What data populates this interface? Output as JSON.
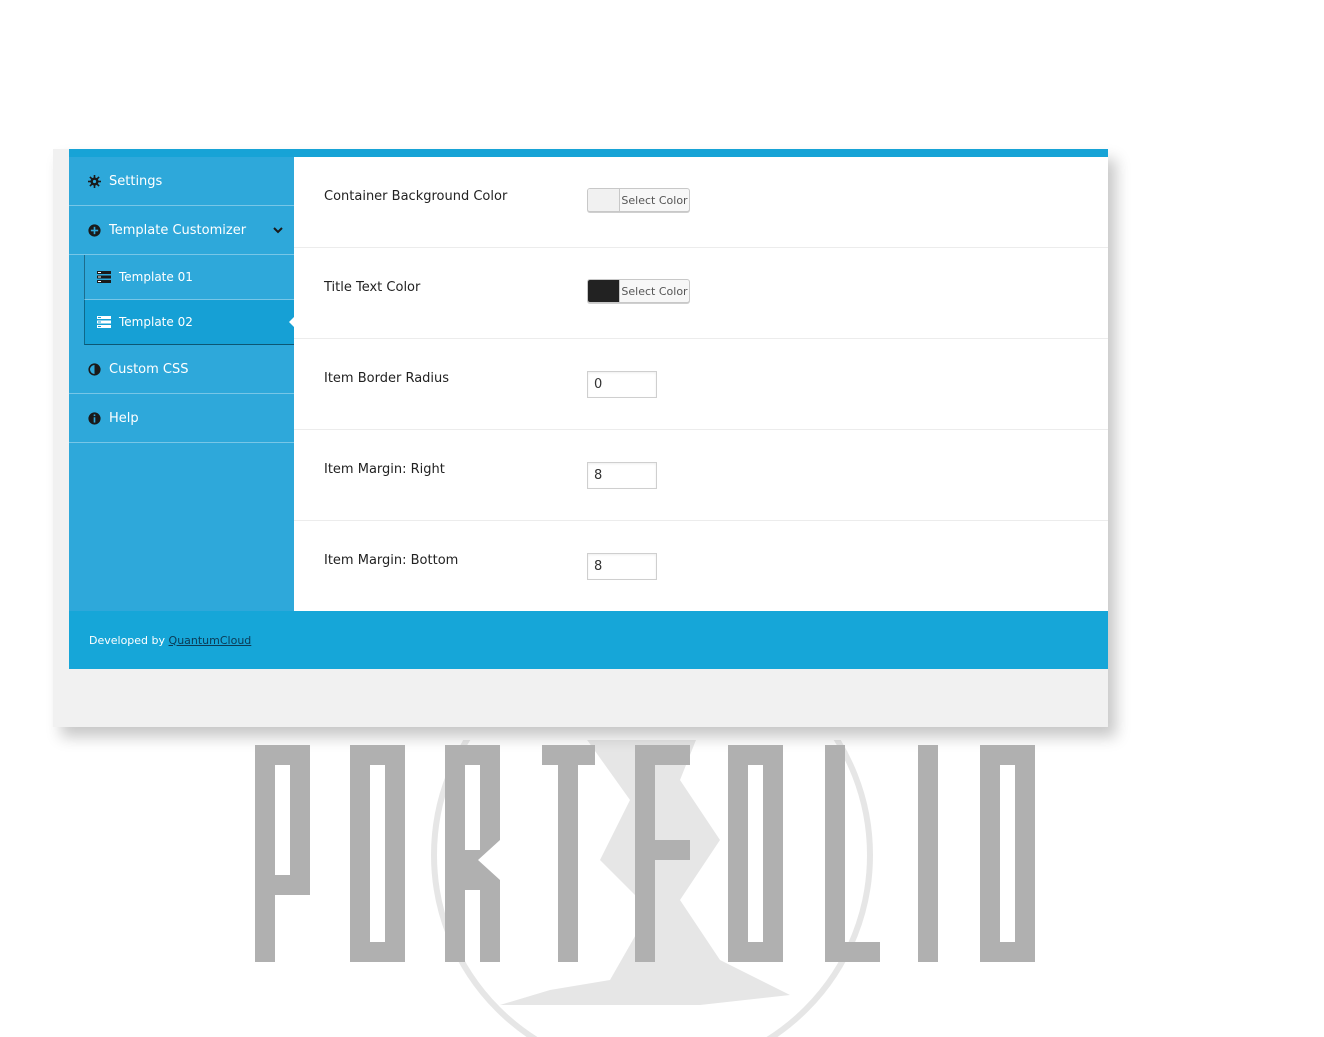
{
  "sidebar": {
    "items": [
      {
        "label": "Settings",
        "icon": "gear-icon"
      },
      {
        "label": "Template Customizer",
        "icon": "plus-circle-icon",
        "expanded": true
      },
      {
        "label": "Custom CSS",
        "icon": "half-circle-icon"
      },
      {
        "label": "Help",
        "icon": "info-icon"
      }
    ],
    "subitems": [
      {
        "label": "Template 01",
        "icon": "list-icon"
      },
      {
        "label": "Template 02",
        "icon": "list-icon",
        "active": true
      }
    ]
  },
  "settings": {
    "container_bg": {
      "label": "Container Background Color",
      "button": "Select Color",
      "color": "#f1f1f1"
    },
    "title_text": {
      "label": "Title Text Color",
      "button": "Select Color",
      "color": "#222222"
    },
    "border_radius": {
      "label": "Item Border Radius",
      "value": "0"
    },
    "margin_right": {
      "label": "Item Margin: Right",
      "value": "8"
    },
    "margin_bottom": {
      "label": "Item Margin: Bottom",
      "value": "8"
    }
  },
  "footer": {
    "prefix": "Developed by ",
    "link": "QuantumCloud"
  },
  "watermark": {
    "text": "PORTFOLIO"
  },
  "colors": {
    "accent": "#2ea8da",
    "accent_dark": "#16a6d8",
    "watermark": "#b0b0b0"
  }
}
